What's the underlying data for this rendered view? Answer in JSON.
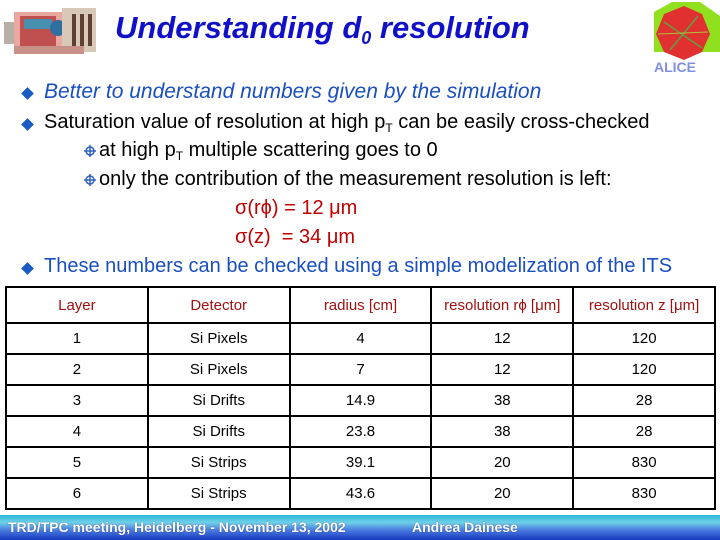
{
  "header": {
    "title_main": "Understanding d",
    "title_sub": "0",
    "title_tail": " resolution",
    "logo_left": "detector-illustration",
    "logo_right": "alice-logo",
    "logo_right_text": "ALICE"
  },
  "bullets": [
    {
      "text": "Better to understand numbers given by the simulation"
    },
    {
      "text_a": "Saturation value of resolution at high p",
      "sub": "T",
      "text_b": " can be easily cross-checked"
    }
  ],
  "sub_bullets": [
    {
      "text_a": "at high p",
      "sub": "T",
      "text_b": " multiple scattering goes to 0"
    },
    {
      "text": "only the contribution of the measurement resolution is left:"
    }
  ],
  "formulas": [
    "σ(rϕ) = 12 μm",
    "σ(z)  = 34 μm"
  ],
  "bullet3": {
    "text": "These numbers can be checked using a simple modelization of the ITS"
  },
  "table": {
    "headers": [
      "Layer",
      "Detector",
      "radius [cm]",
      "resolution rϕ [μm]",
      "resolution z [μm]"
    ],
    "rows": [
      [
        "1",
        "Si Pixels",
        "4",
        "12",
        "120"
      ],
      [
        "2",
        "Si Pixels",
        "7",
        "12",
        "120"
      ],
      [
        "3",
        "Si Drifts",
        "14.9",
        "38",
        "28"
      ],
      [
        "4",
        "Si Drifts",
        "23.8",
        "38",
        "28"
      ],
      [
        "5",
        "Si Strips",
        "39.1",
        "20",
        "830"
      ],
      [
        "6",
        "Si Strips",
        "43.6",
        "20",
        "830"
      ]
    ]
  },
  "footer": {
    "meeting": "TRD/TPC meeting, Heidelberg - November 13, 2002",
    "author": "Andrea Dainese"
  },
  "colors": {
    "title": "#1010c8",
    "bullet_text": "#1a4fc0",
    "formula": "#c00000",
    "table_header": "#a01010"
  }
}
